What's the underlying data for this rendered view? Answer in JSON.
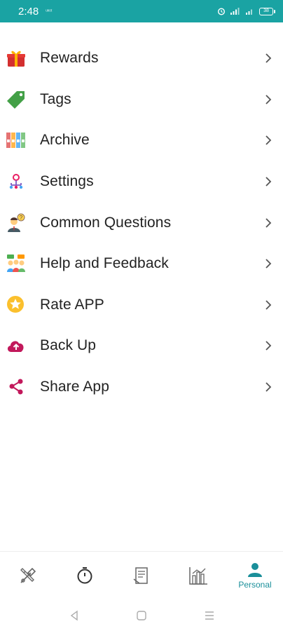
{
  "status_bar": {
    "time": "2:48",
    "carrier": "ᵘᵏᵒᵗ",
    "battery": "38",
    "icons": [
      "alarm-icon",
      "signal-icon",
      "signal-icon",
      "battery-icon"
    ],
    "color": "#1aa3a3"
  },
  "menu": {
    "items": [
      {
        "label": "Rewards",
        "icon": "gift-icon"
      },
      {
        "label": "Tags",
        "icon": "tag-icon"
      },
      {
        "label": "Archive",
        "icon": "archive-binders-icon"
      },
      {
        "label": "Settings",
        "icon": "settings-network-icon"
      },
      {
        "label": "Common Questions",
        "icon": "question-person-icon"
      },
      {
        "label": "Help and Feedback",
        "icon": "people-feedback-icon"
      },
      {
        "label": "Rate APP",
        "icon": "star-icon"
      },
      {
        "label": "Back Up",
        "icon": "cloud-upload-icon"
      },
      {
        "label": "Share App",
        "icon": "share-icon"
      }
    ]
  },
  "bottom_nav": {
    "tabs": [
      {
        "icon": "tools-icon",
        "label": ""
      },
      {
        "icon": "timer-icon",
        "label": ""
      },
      {
        "icon": "notes-icon",
        "label": ""
      },
      {
        "icon": "stats-chart-icon",
        "label": ""
      },
      {
        "icon": "person-icon",
        "label": "Personal"
      }
    ],
    "active_color": "#1a8f9a"
  },
  "system_nav": {
    "buttons": [
      "back-icon",
      "home-icon",
      "recents-icon"
    ]
  }
}
